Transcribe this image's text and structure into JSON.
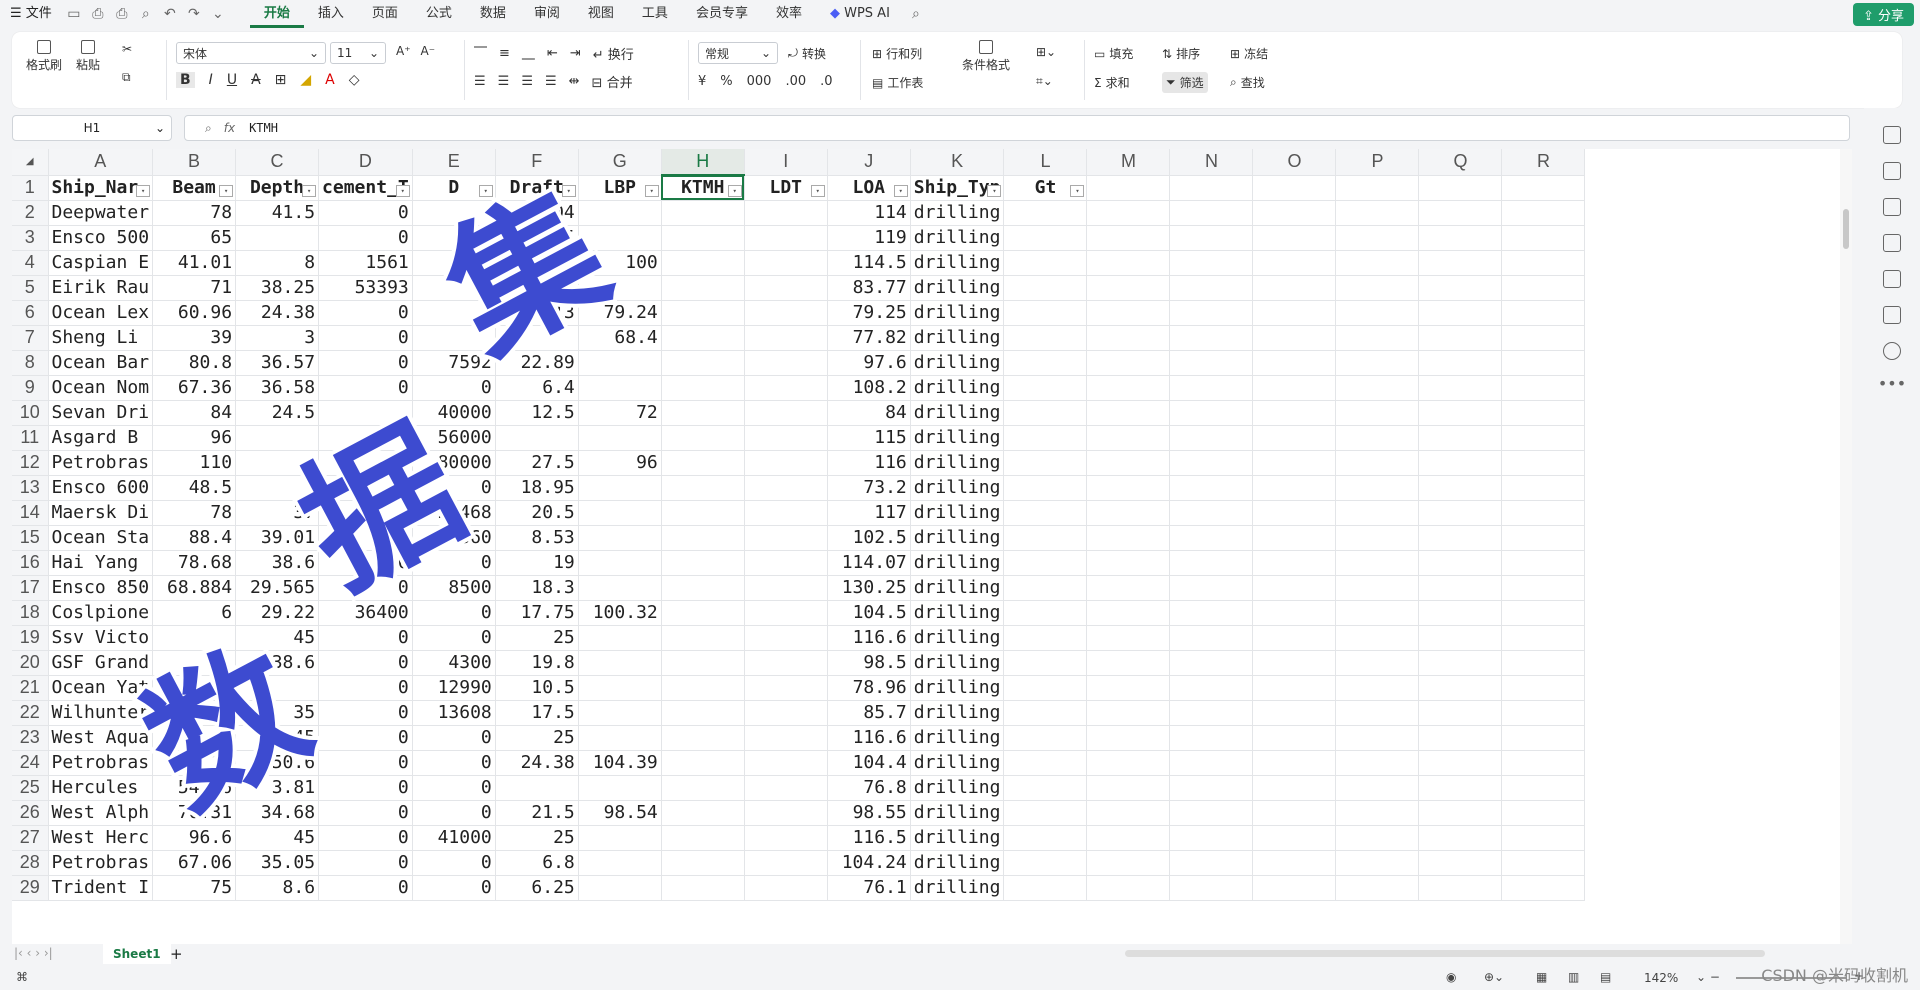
{
  "menu": {
    "file": "文件",
    "tabs": [
      "开始",
      "插入",
      "页面",
      "公式",
      "数据",
      "审阅",
      "视图",
      "工具",
      "会员专享",
      "效率"
    ],
    "ai": "WPS AI",
    "share": "分享"
  },
  "ribbon": {
    "format_painter": "格式刷",
    "paste": "粘贴",
    "font_name": "宋体",
    "font_size": "11",
    "wrap": "换行",
    "number_format": "常规",
    "convert": "转换",
    "row_col": "行和列",
    "worksheet": "工作表",
    "conditional": "条件格式",
    "merge": "合并",
    "fill": "填充",
    "sort": "排序",
    "freeze": "冻结",
    "sum": "求和",
    "filter": "筛选",
    "find": "查找"
  },
  "formula": {
    "cell_ref": "H1",
    "fx": "fx",
    "value": "KTMH"
  },
  "columns": [
    "A",
    "B",
    "C",
    "D",
    "E",
    "F",
    "G",
    "H",
    "I",
    "J",
    "K",
    "L",
    "M",
    "N",
    "O",
    "P",
    "Q",
    "R"
  ],
  "header_row": [
    "Ship_Nar",
    "Beam",
    "Depth",
    "cement_T",
    "D",
    "Draft",
    "LBP",
    "KTMH",
    "LDT",
    "LOA",
    "Ship_Typ",
    "Gt"
  ],
  "rows": [
    {
      "n": "2",
      "c": [
        "Deepwater",
        "78",
        "41.5",
        "0",
        "",
        "28.04",
        "",
        "",
        "",
        "114",
        "drilling",
        ""
      ]
    },
    {
      "n": "3",
      "c": [
        "Ensco 500",
        "65",
        "",
        "0",
        "",
        "75",
        "",
        "",
        "",
        "119",
        "drilling",
        ""
      ]
    },
    {
      "n": "4",
      "c": [
        "Caspian E",
        "41.01",
        "8",
        "1561",
        "",
        "14.03",
        "100",
        "",
        "",
        "114.5",
        "drilling",
        ""
      ]
    },
    {
      "n": "5",
      "c": [
        "Eirik Rau",
        "71",
        "38.25",
        "53393",
        "",
        "23.75",
        "",
        "",
        "",
        "83.77",
        "drilling",
        ""
      ]
    },
    {
      "n": "6",
      "c": [
        "Ocean Lex",
        "60.96",
        "24.38",
        "0",
        "",
        "13.13",
        "79.24",
        "",
        "",
        "79.25",
        "drilling",
        ""
      ]
    },
    {
      "n": "7",
      "c": [
        "Sheng Li",
        "39",
        "3",
        "0",
        "",
        "",
        "68.4",
        "",
        "",
        "77.82",
        "drilling",
        ""
      ]
    },
    {
      "n": "8",
      "c": [
        "Ocean Bar",
        "80.8",
        "36.57",
        "0",
        "7592",
        "22.89",
        "",
        "",
        "",
        "97.6",
        "drilling",
        ""
      ]
    },
    {
      "n": "9",
      "c": [
        "Ocean Nom",
        "67.36",
        "36.58",
        "0",
        "0",
        "6.4",
        "",
        "",
        "",
        "108.2",
        "drilling",
        ""
      ]
    },
    {
      "n": "10",
      "c": [
        "Sevan Dri",
        "84",
        "24.5",
        "",
        "40000",
        "12.5",
        "72",
        "",
        "",
        "84",
        "drilling",
        ""
      ]
    },
    {
      "n": "11",
      "c": [
        "Asgard B",
        "96",
        "",
        "",
        "56000",
        "",
        "",
        "",
        "",
        "115",
        "drilling",
        ""
      ]
    },
    {
      "n": "12",
      "c": [
        "Petrobras",
        "110",
        "",
        "",
        "80000",
        "27.5",
        "96",
        "",
        "",
        "116",
        "drilling",
        ""
      ]
    },
    {
      "n": "13",
      "c": [
        "Ensco 600",
        "48.5",
        "",
        "",
        "0",
        "18.95",
        "",
        "",
        "",
        "73.2",
        "drilling",
        ""
      ]
    },
    {
      "n": "14",
      "c": [
        "Maersk Di",
        "78",
        "37",
        "",
        "23468",
        "20.5",
        "",
        "",
        "",
        "117",
        "drilling",
        ""
      ]
    },
    {
      "n": "15",
      "c": [
        "Ocean Sta",
        "88.4",
        "39.01",
        "0",
        "21660",
        "8.53",
        "",
        "",
        "",
        "102.5",
        "drilling",
        ""
      ]
    },
    {
      "n": "16",
      "c": [
        "Hai Yang",
        "78.68",
        "38.6",
        "0",
        "0",
        "19",
        "",
        "",
        "",
        "114.07",
        "drilling",
        ""
      ]
    },
    {
      "n": "17",
      "c": [
        "Ensco 850",
        "68.884",
        "29.565",
        "0",
        "8500",
        "18.3",
        "",
        "",
        "",
        "130.25",
        "drilling",
        ""
      ]
    },
    {
      "n": "18",
      "c": [
        "Coslpione",
        "6",
        "29.22",
        "36400",
        "0",
        "17.75",
        "100.32",
        "",
        "",
        "104.5",
        "drilling",
        ""
      ]
    },
    {
      "n": "19",
      "c": [
        "Ssv Victo",
        "",
        "45",
        "0",
        "0",
        "25",
        "",
        "",
        "",
        "116.6",
        "drilling",
        ""
      ]
    },
    {
      "n": "20",
      "c": [
        "GSF Grand",
        "",
        "38.6",
        "0",
        "4300",
        "19.8",
        "",
        "",
        "",
        "98.5",
        "drilling",
        ""
      ]
    },
    {
      "n": "21",
      "c": [
        "Ocean Yat",
        "",
        "",
        "0",
        "12990",
        "10.5",
        "",
        "",
        "",
        "78.96",
        "drilling",
        ""
      ]
    },
    {
      "n": "22",
      "c": [
        "Wilhunter",
        "",
        "35",
        "0",
        "13608",
        "17.5",
        "",
        "",
        "",
        "85.7",
        "drilling",
        ""
      ]
    },
    {
      "n": "23",
      "c": [
        "West Aqua",
        "",
        "45",
        "0",
        "0",
        "25",
        "",
        "",
        "",
        "116.6",
        "drilling",
        ""
      ]
    },
    {
      "n": "24",
      "c": [
        "Petrobras",
        "10",
        "50.6",
        "0",
        "0",
        "24.38",
        "104.39",
        "",
        "",
        "104.4",
        "drilling",
        ""
      ]
    },
    {
      "n": "25",
      "c": [
        "Hercules",
        "54.86",
        "3.81",
        "0",
        "0",
        "",
        "",
        "",
        "",
        "76.8",
        "drilling",
        ""
      ]
    },
    {
      "n": "26",
      "c": [
        "West Alph",
        "76.31",
        "34.68",
        "0",
        "0",
        "21.5",
        "98.54",
        "",
        "",
        "98.55",
        "drilling",
        ""
      ]
    },
    {
      "n": "27",
      "c": [
        "West Herc",
        "96.6",
        "45",
        "0",
        "41000",
        "25",
        "",
        "",
        "",
        "116.5",
        "drilling",
        ""
      ]
    },
    {
      "n": "28",
      "c": [
        "Petrobras",
        "67.06",
        "35.05",
        "0",
        "0",
        "6.8",
        "",
        "",
        "",
        "104.24",
        "drilling",
        ""
      ]
    },
    {
      "n": "29",
      "c": [
        "Trident I",
        "75",
        "8.6",
        "0",
        "0",
        "6.25",
        "",
        "",
        "",
        "76.1",
        "drilling",
        ""
      ]
    }
  ],
  "sheet_tab": "Sheet1",
  "zoom": "142%",
  "watermark": [
    "数",
    "据",
    "集"
  ],
  "csdn": "CSDN @米码收割机"
}
